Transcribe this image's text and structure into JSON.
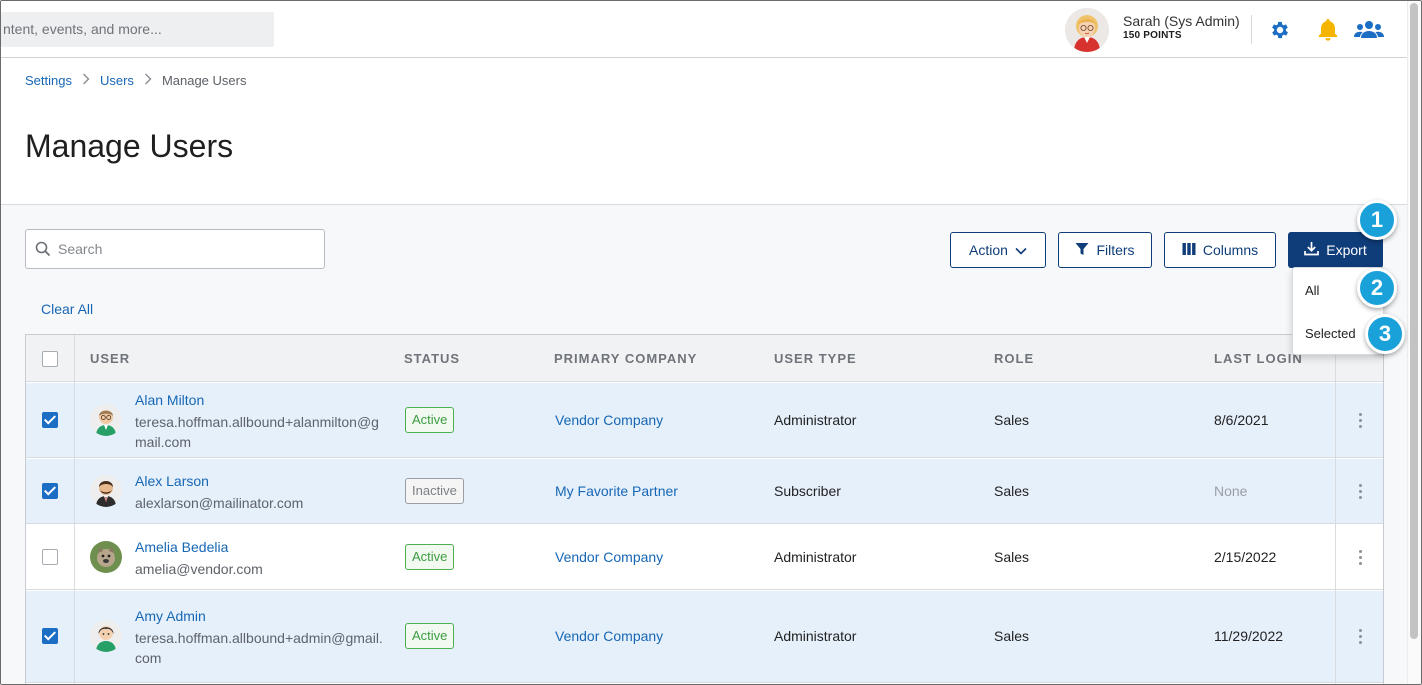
{
  "header": {
    "search_placeholder": "ntent, events, and more...",
    "user_name": "Sarah (Sys Admin)",
    "user_points": "150 POINTS",
    "icons": [
      "gear-icon",
      "bell-icon",
      "users-icon"
    ],
    "accent_color": "#1c6dc4",
    "bell_color": "#f5b400"
  },
  "breadcrumb": {
    "items": [
      "Settings",
      "Users",
      "Manage Users"
    ]
  },
  "page": {
    "title": "Manage Users"
  },
  "toolbar": {
    "search_placeholder": "Search",
    "action_label": "Action",
    "filters_label": "Filters",
    "columns_label": "Columns",
    "export_label": "Export",
    "clear_all_label": "Clear All"
  },
  "export_menu": {
    "items": [
      "All",
      "Selected"
    ]
  },
  "callouts": [
    "1",
    "2",
    "3"
  ],
  "table": {
    "columns": [
      "USER",
      "STATUS",
      "PRIMARY COMPANY",
      "USER TYPE",
      "ROLE",
      "LAST LOGIN"
    ],
    "rows": [
      {
        "selected": true,
        "name": "Alan Milton",
        "email": "teresa.hoffman.allbound+alanmilton@gmail.com",
        "status": "Active",
        "company": "Vendor Company",
        "user_type": "Administrator",
        "role": "Sales",
        "last_login": "8/6/2021"
      },
      {
        "selected": true,
        "name": "Alex Larson",
        "email": "alexlarson@mailinator.com",
        "status": "Inactive",
        "company": "My Favorite Partner",
        "user_type": "Subscriber",
        "role": "Sales",
        "last_login": "None"
      },
      {
        "selected": false,
        "name": "Amelia Bedelia",
        "email": "amelia@vendor.com",
        "status": "Active",
        "company": "Vendor Company",
        "user_type": "Administrator",
        "role": "Sales",
        "last_login": "2/15/2022"
      },
      {
        "selected": true,
        "name": "Amy Admin",
        "email": "teresa.hoffman.allbound+admin@gmail.com",
        "status": "Active",
        "company": "Vendor Company",
        "user_type": "Administrator",
        "role": "Sales",
        "last_login": "11/29/2022"
      }
    ]
  },
  "colors": {
    "primary_button": "#0f3d7a",
    "link": "#1767b5",
    "callout": "#1aa1d9",
    "selected_row": "#e6f0fb",
    "active_status": "#3d9c41"
  }
}
